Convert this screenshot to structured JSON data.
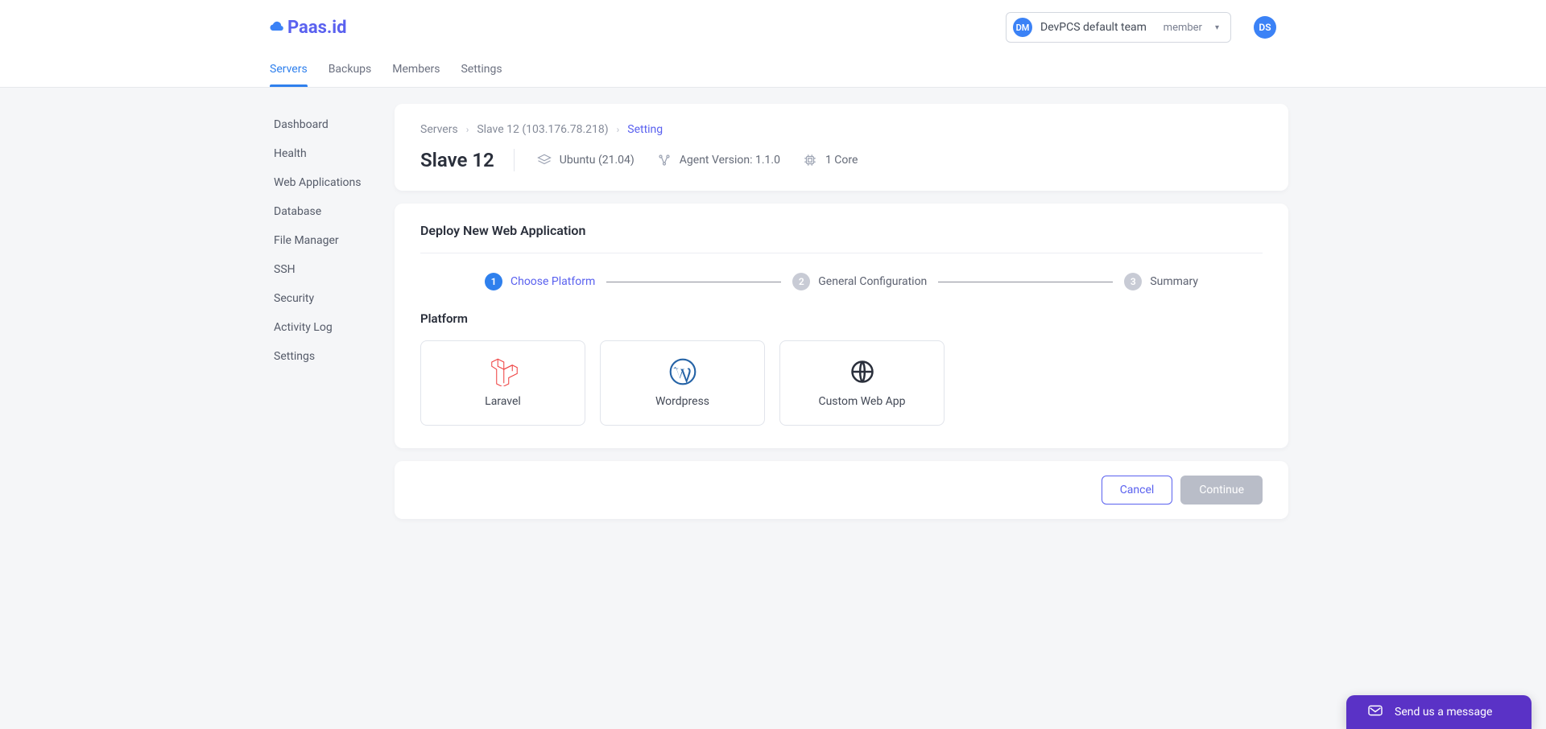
{
  "brand": {
    "name": "Paas.id"
  },
  "team": {
    "avatar": "DM",
    "name": "DevPCS default team",
    "role": "member"
  },
  "user": {
    "avatar": "DS"
  },
  "topnav": [
    {
      "label": "Servers",
      "active": true
    },
    {
      "label": "Backups"
    },
    {
      "label": "Members"
    },
    {
      "label": "Settings"
    }
  ],
  "sidenav": [
    "Dashboard",
    "Health",
    "Web Applications",
    "Database",
    "File Manager",
    "SSH",
    "Security",
    "Activity Log",
    "Settings"
  ],
  "breadcrumb": {
    "servers": "Servers",
    "server": "Slave 12 (103.176.78.218)",
    "current": "Setting"
  },
  "server": {
    "name": "Slave 12",
    "os": "Ubuntu (21.04)",
    "agent": "Agent Version: 1.1.0",
    "cores": "1 Core"
  },
  "deploy": {
    "title": "Deploy New Web Application",
    "steps": [
      {
        "num": "1",
        "label": "Choose Platform",
        "active": true
      },
      {
        "num": "2",
        "label": "General Configuration"
      },
      {
        "num": "3",
        "label": "Summary"
      }
    ],
    "platform_title": "Platform",
    "platforms": [
      {
        "label": "Laravel",
        "icon": "laravel"
      },
      {
        "label": "Wordpress",
        "icon": "wordpress"
      },
      {
        "label": "Custom Web App",
        "icon": "globe"
      }
    ]
  },
  "actions": {
    "cancel": "Cancel",
    "continue": "Continue"
  },
  "chat": {
    "label": "Send us a message"
  }
}
